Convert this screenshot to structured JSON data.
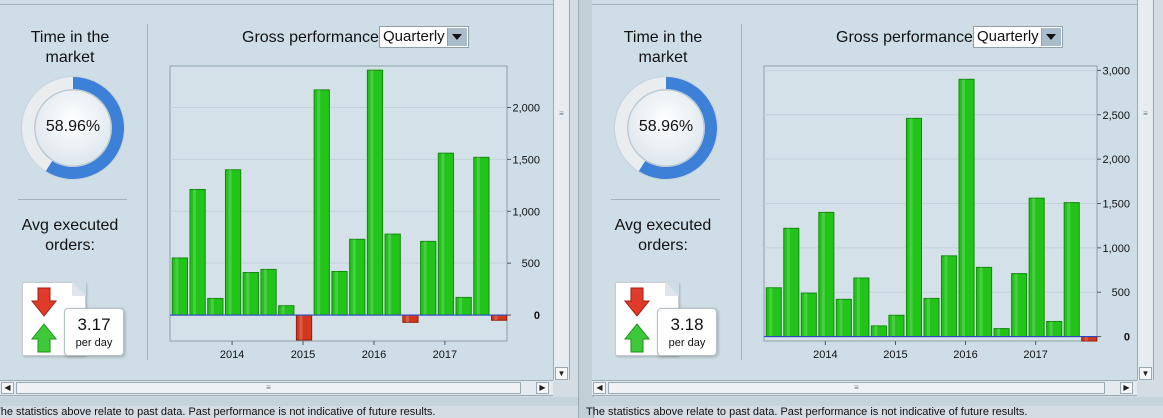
{
  "panels": [
    {
      "time_title": "Time in the market",
      "time_pct": "58.96%",
      "time_fraction": 0.5896,
      "avg_title": "Avg executed orders:",
      "avg_value": "3.17",
      "avg_unit": "per day",
      "gross_label": "Gross performance",
      "period_selected": "Quarterly",
      "chart_data": {
        "type": "bar",
        "x_ticks": [
          "2014",
          "2015",
          "2016",
          "2017"
        ],
        "y_ticks": [
          "2,000",
          "1,500",
          "1,000",
          "500",
          "0"
        ],
        "ylim": [
          -250,
          2400
        ],
        "values": [
          550,
          1210,
          160,
          1400,
          410,
          440,
          90,
          -240,
          2170,
          420,
          730,
          2360,
          780,
          -70,
          710,
          1560,
          170,
          1520,
          -50
        ],
        "colors": {
          "positive": "#22c41a",
          "negative": "#d0391f"
        }
      }
    },
    {
      "time_title": "Time in the market",
      "time_pct": "58.96%",
      "time_fraction": 0.5896,
      "avg_title": "Avg executed orders:",
      "avg_value": "3.18",
      "avg_unit": "per day",
      "gross_label": "Gross performance",
      "period_selected": "Quarterly",
      "chart_data": {
        "type": "bar",
        "x_ticks": [
          "2014",
          "2015",
          "2016",
          "2017"
        ],
        "y_ticks": [
          "3,000",
          "2,500",
          "2,000",
          "1,500",
          "1,000",
          "500",
          "0"
        ],
        "ylim": [
          -50,
          3050
        ],
        "values": [
          550,
          1220,
          490,
          1400,
          420,
          660,
          120,
          240,
          2460,
          430,
          910,
          2900,
          780,
          90,
          710,
          1560,
          170,
          1510,
          -50
        ],
        "colors": {
          "positive": "#22c41a",
          "negative": "#d0391f"
        }
      }
    }
  ],
  "footer_text": "The statistics above relate to past data. Past performance is not indicative of future results."
}
